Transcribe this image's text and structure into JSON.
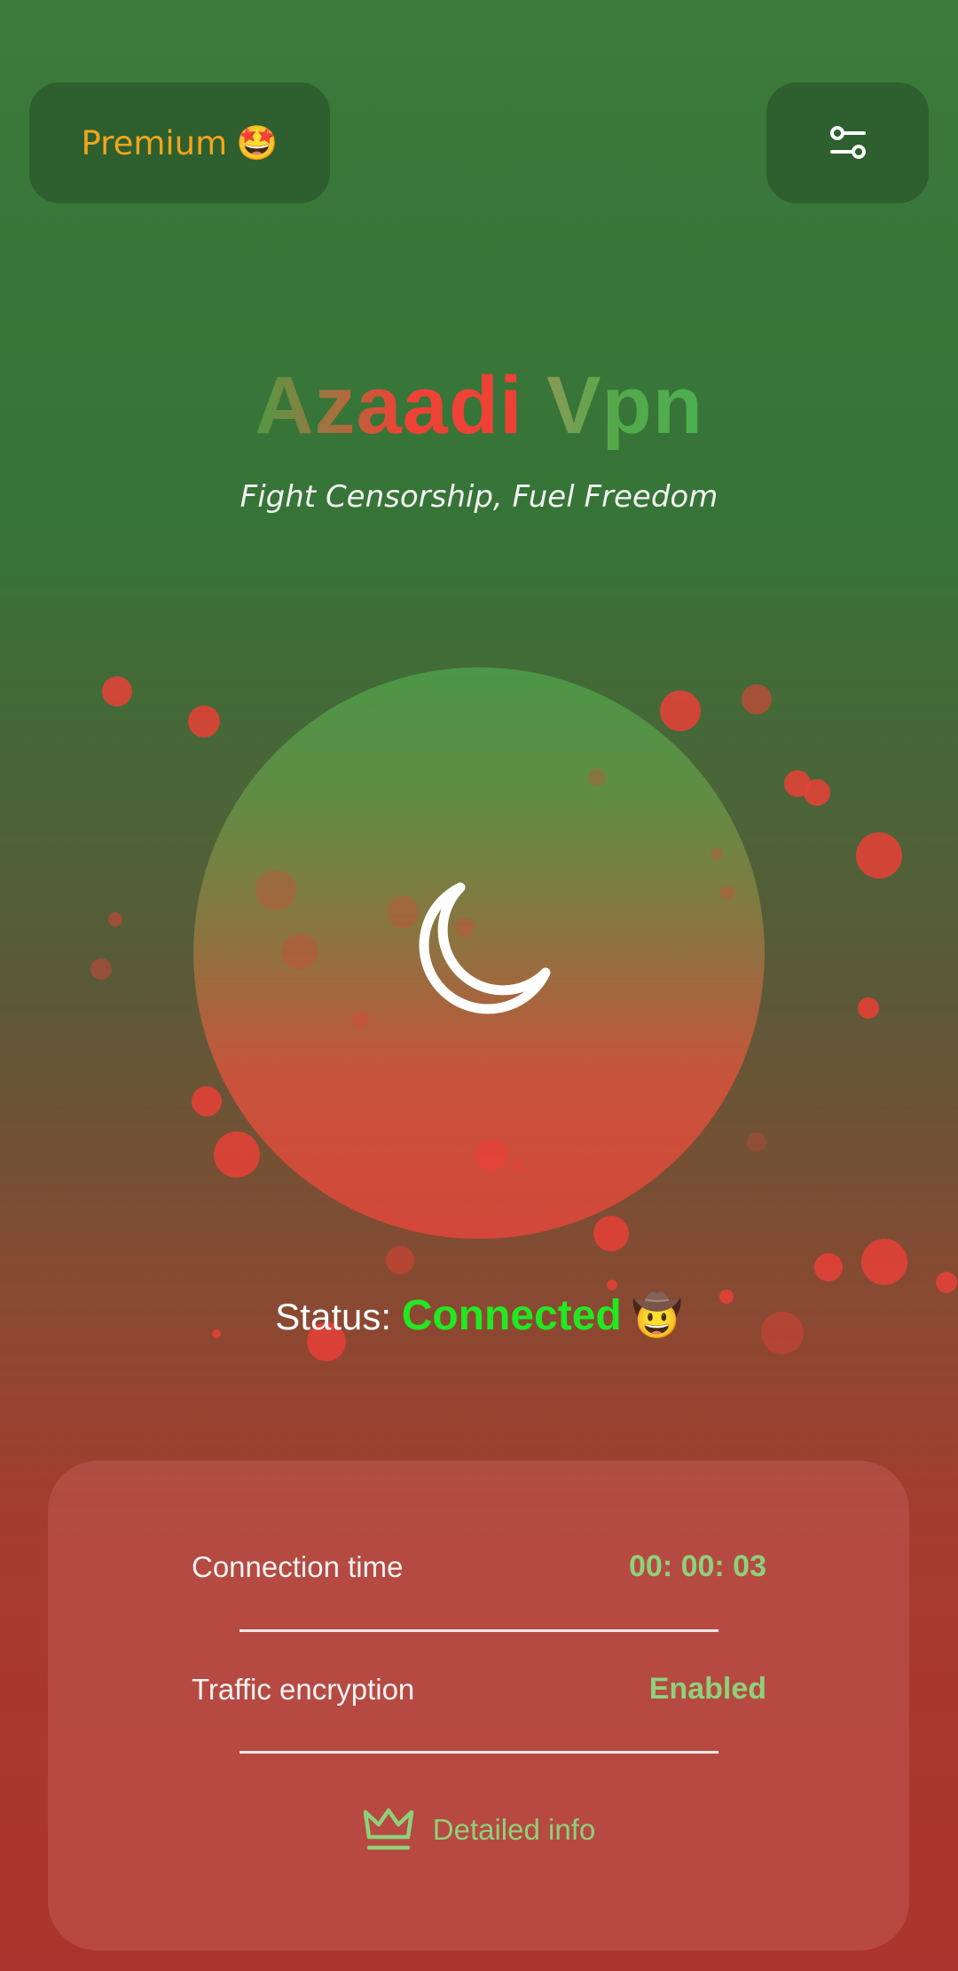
{
  "header": {
    "premium_label": "Premium",
    "premium_emoji": "🤩",
    "settings_icon": "sliders-icon"
  },
  "brand": {
    "title_part1": "Azaadi",
    "title_part2": "Vpn",
    "subtitle": "Fight Censorship, Fuel Freedom"
  },
  "power_button": {
    "icon": "moon-icon"
  },
  "status": {
    "label": "Status:",
    "value": "Connected",
    "emoji": "🤠"
  },
  "info": {
    "rows": [
      {
        "label": "Connection time",
        "value": "00: 00: 03"
      },
      {
        "label": "Traffic encryption",
        "value": "Enabled"
      }
    ],
    "detail_label": "Detailed info",
    "detail_icon": "crown-icon"
  },
  "colors": {
    "accent_green": "#8ed17a",
    "status_green": "#22e822",
    "premium_orange": "#f2a51b",
    "title_red": "#e8453a",
    "title_green": "#4caf50"
  }
}
